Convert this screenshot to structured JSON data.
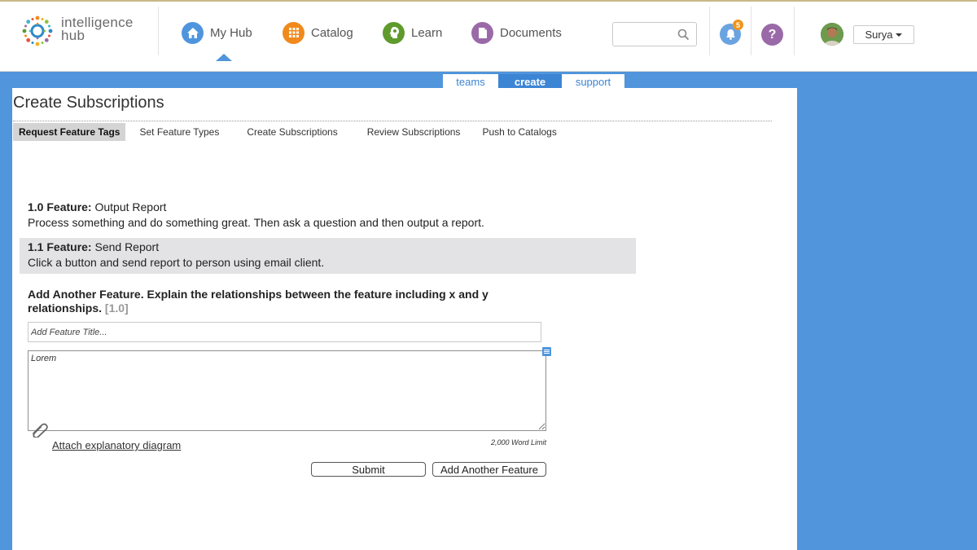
{
  "app": {
    "logo_line1": "intelligence",
    "logo_line2": "hub"
  },
  "nav": [
    {
      "label": "My Hub",
      "icon": "home-icon",
      "color": "#4f95dd"
    },
    {
      "label": "Catalog",
      "icon": "grid-icon",
      "color": "#f08a1c"
    },
    {
      "label": "Learn",
      "icon": "head-icon",
      "color": "#5e9a2c"
    },
    {
      "label": "Documents",
      "icon": "document-icon",
      "color": "#9a6aa8"
    }
  ],
  "search": {
    "placeholder": ""
  },
  "notifications": {
    "count": "5"
  },
  "help": {
    "label": "?"
  },
  "user": {
    "name": "Surya"
  },
  "subtabs": [
    {
      "label": "teams",
      "active": false
    },
    {
      "label": "create",
      "active": true
    },
    {
      "label": "support",
      "active": false
    }
  ],
  "page": {
    "title": "Create Subscriptions",
    "steps": [
      "Request Feature Tags",
      "Set Feature Types",
      "Create Subscriptions",
      "Review Subscriptions",
      "Push to Catalogs"
    ]
  },
  "features": [
    {
      "num": "1.0 Feature:",
      "name": "Output Report",
      "desc": "Process something and do something great. Then ask a question and then output a report."
    },
    {
      "num": "1.1 Feature:",
      "name": "Send Report",
      "desc": "Click a button and send report to person using email client."
    }
  ],
  "form": {
    "heading": "Add Another Feature. Explain the relationships between the feature including x and y relationships.",
    "ref": "[1.0]",
    "title_placeholder": "Add Feature Title...",
    "desc_value": "Lorem",
    "word_limit": "2,000 Word Limit",
    "attach_label": "Attach explanatory diagram",
    "submit_label": "Submit",
    "add_label": "Add Another Feature"
  },
  "colors": {
    "accent_blue": "#5195dc",
    "active_subtab": "#3c85d4",
    "badge": "#f0941a"
  }
}
